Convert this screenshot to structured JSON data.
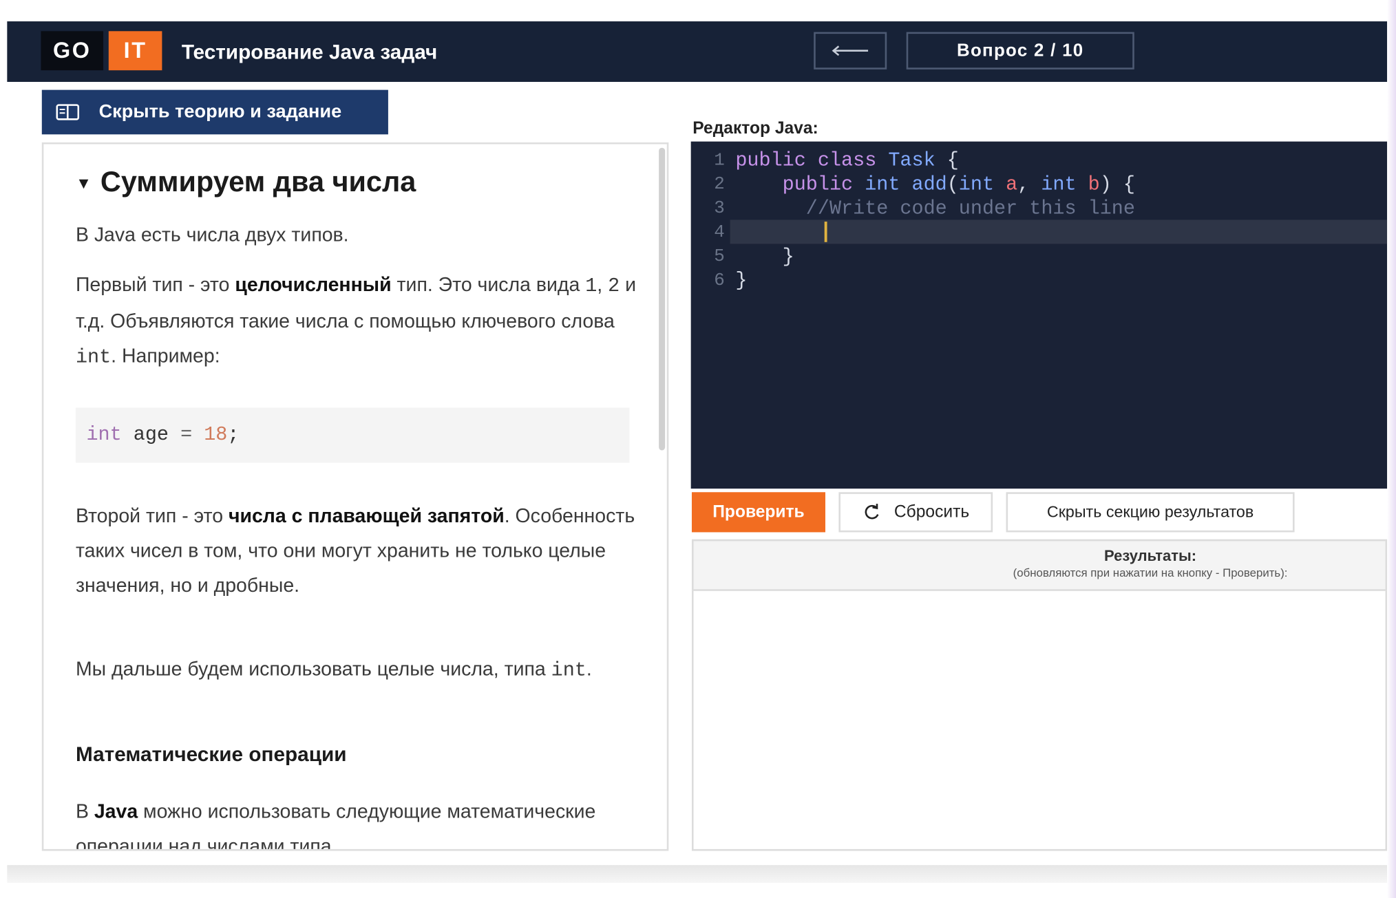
{
  "header": {
    "logo_left": "GO",
    "logo_right": "IT",
    "title": "Тестирование Java задач",
    "back_icon": "arrow-left-icon",
    "question_counter": "Вопрос 2 / 10"
  },
  "toolbar": {
    "toggle_theory_label": "Скрыть теорию и задание",
    "toggle_icon": "book-open-icon"
  },
  "theory": {
    "title": "Суммируем два числа",
    "p1": "В Java есть числа двух типов.",
    "p2": {
      "pre": "Первый тип - это ",
      "bold": "целочисленный",
      "post1": " тип. Это числа вида ",
      "code1": "1",
      "sep": ", ",
      "code2": "2",
      "post2": " и т.д. Объявляются такие числа с помощью ключевого слова ",
      "code3": "int",
      "post3": ". Например:"
    },
    "code_example": {
      "kw": "int",
      "name": " age ",
      "op": "=",
      "num": " 18",
      "end": ";"
    },
    "p3": {
      "pre": "Второй тип - это ",
      "bold": "числа с плавающей запятой",
      "post": ". Особенность таких чисел в том, что они могут хранить не только целые значения, но и дробные."
    },
    "p4": {
      "pre": "Мы дальше будем использовать целые числа, типа ",
      "code": "int",
      "post": "."
    },
    "subheading": "Математические операции",
    "p5": {
      "pre": "В ",
      "bold": "Java",
      "post": " можно использовать следующие математические операции над числами типа"
    }
  },
  "editor": {
    "label": "Редактор Java:",
    "line_numbers": [
      "1",
      "2",
      "3",
      "4",
      "5",
      "6"
    ],
    "active_line": 4
  },
  "buttons": {
    "check": "Проверить",
    "reset": "Сбросить",
    "reset_icon": "refresh-icon",
    "hide_results": "Скрыть секцию результатов"
  },
  "results": {
    "title": "Результаты:",
    "hint": "(обновляются при нажатии на кнопку - Проверить):"
  },
  "colors": {
    "header_bg": "#172237",
    "accent_orange": "#f26d21",
    "toggle_blue": "#1e3a6b",
    "editor_bg": "#1a2236"
  }
}
